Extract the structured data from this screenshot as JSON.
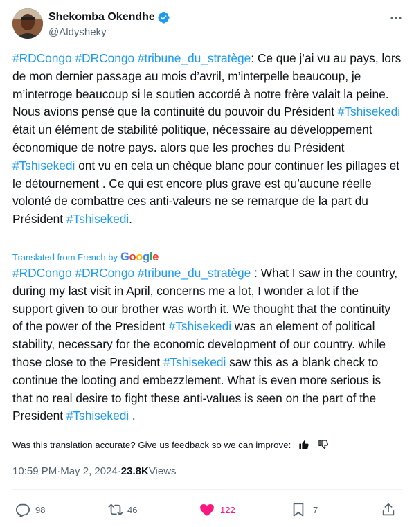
{
  "author": {
    "name": "Shekomba Okendhe",
    "handle": "@Aldysheky"
  },
  "original_text": [
    {
      "t": "#RDCongo",
      "tag": true
    },
    {
      "t": " ",
      "tag": false
    },
    {
      "t": "#DRCongo",
      "tag": true
    },
    {
      "t": " ",
      "tag": false
    },
    {
      "t": "#tribune_du_stratège",
      "tag": true
    },
    {
      "t": ": Ce que j’ai vu au pays, lors de mon dernier passage au mois d’avril, m’interpelle beaucoup, je m’interroge beaucoup si le soutien accordé à notre frère valait la peine. Nous avions pensé que la continuité du pouvoir du Président ",
      "tag": false
    },
    {
      "t": "#Tshisekedi",
      "tag": true
    },
    {
      "t": " était un élément de stabilité politique, nécessaire au développement économique de notre pays. alors que les proches du Président ",
      "tag": false
    },
    {
      "t": "#Tshisekedi",
      "tag": true
    },
    {
      "t": " ont vu en cela un chèque blanc pour continuer les pillages et le détournement . Ce qui est encore plus grave est qu’aucune réelle volonté de combattre ces anti-valeurs ne se remarque de la part du Président ",
      "tag": false
    },
    {
      "t": "#Tshisekedi",
      "tag": true
    },
    {
      "t": ".",
      "tag": false
    }
  ],
  "translation_label": "Translated from French by",
  "translation_provider": "Google",
  "translated_text": [
    {
      "t": "#RDCongo",
      "tag": true
    },
    {
      "t": " ",
      "tag": false
    },
    {
      "t": "#DRCongo",
      "tag": true
    },
    {
      "t": " ",
      "tag": false
    },
    {
      "t": "#tribune_du_stratège",
      "tag": true
    },
    {
      "t": " : What I saw in the country, during my last visit in April, concerns me a lot, I wonder a lot if the support given to our brother was worth it. We thought that the continuity of the power of the President ",
      "tag": false
    },
    {
      "t": "#Tshisekedi",
      "tag": true
    },
    {
      "t": " was an element of political stability, necessary for the economic development of our country. while those close to the President ",
      "tag": false
    },
    {
      "t": "#Tshisekedi",
      "tag": true
    },
    {
      "t": " saw this as a blank check to continue the looting and embezzlement. What is even more serious is that no real desire to fight these anti-values is seen on the part of the President ",
      "tag": false
    },
    {
      "t": "#Tshisekedi",
      "tag": true
    },
    {
      "t": " .",
      "tag": false
    }
  ],
  "feedback_prompt": "Was this translation accurate? Give us feedback so we can improve:",
  "meta": {
    "time": "10:59 PM",
    "separator": " · ",
    "date": "May 2, 2024",
    "views_count": "23.8K",
    "views_label": " Views"
  },
  "actions": {
    "replies": "98",
    "reposts": "46",
    "likes": "122",
    "bookmarks": "7"
  },
  "icons": {
    "verified": "verified-badge-icon",
    "more": "more-options-icon",
    "thumbs_up": "thumbs-up-icon",
    "thumbs_down": "thumbs-down-icon",
    "reply": "reply-icon",
    "repost": "repost-icon",
    "like": "heart-icon",
    "bookmark": "bookmark-icon",
    "share": "share-icon"
  },
  "colors": {
    "link": "#1d9bf0",
    "muted": "#536471",
    "like": "#f91880",
    "text": "#0f1419"
  }
}
